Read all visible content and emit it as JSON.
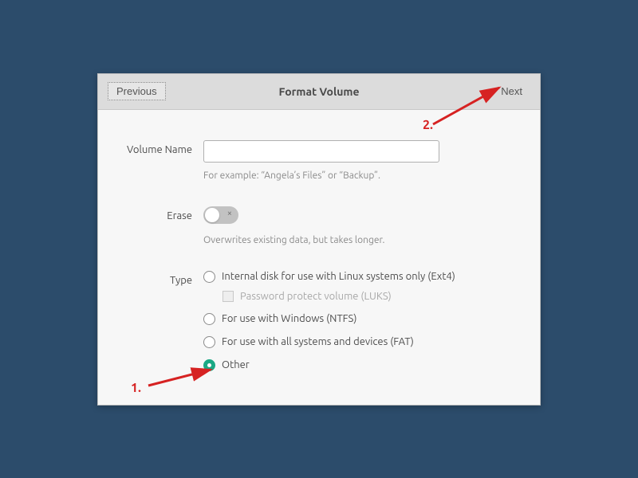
{
  "header": {
    "title": "Format Volume",
    "previous": "Previous",
    "next": "Next"
  },
  "volumeName": {
    "label": "Volume Name",
    "value": "",
    "hint": "For example: “Angela’s Files” or “Backup”."
  },
  "erase": {
    "label": "Erase",
    "hint": "Overwrites existing data, but takes longer."
  },
  "type": {
    "label": "Type",
    "options": {
      "ext4": "Internal disk for use with Linux systems only (Ext4)",
      "luks": "Password protect volume (LUKS)",
      "ntfs": "For use with Windows (NTFS)",
      "fat": "For use with all systems and devices (FAT)",
      "other": "Other"
    }
  },
  "annotations": {
    "one": "1.",
    "two": "2."
  }
}
